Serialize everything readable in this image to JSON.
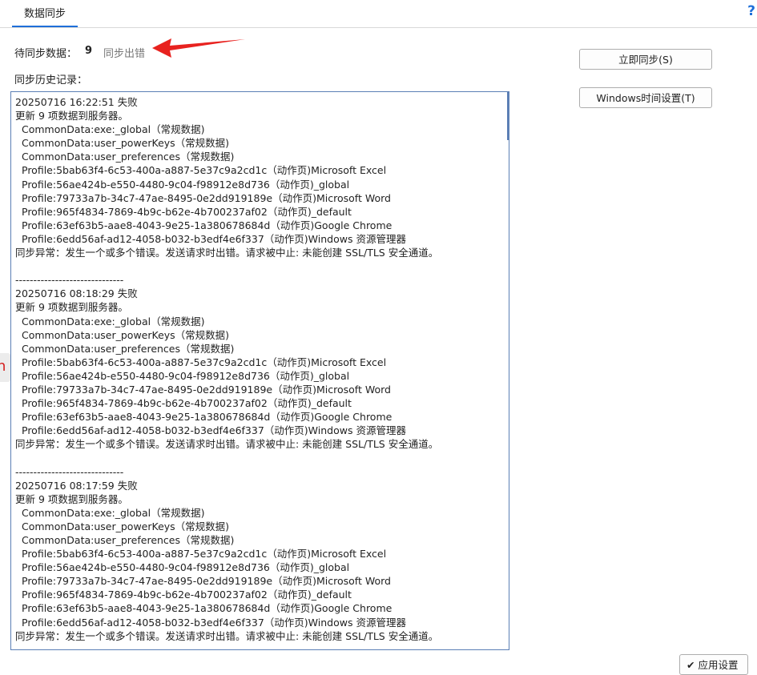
{
  "tabs": [
    {
      "label": "数据同步",
      "active": true
    }
  ],
  "help_label": "?",
  "pending": {
    "label": "待同步数据：",
    "count": "9",
    "status": "同步出错"
  },
  "history": {
    "label": "同步历史记录："
  },
  "buttons": {
    "sync_now": "立即同步(S)",
    "windows_time": "Windows时间设置(T)",
    "apply": "应用设置"
  },
  "side_tab_text": "n",
  "log_entries": [
    {
      "separator": "",
      "header": "20250716 16:22:51 失败",
      "summary": "更新 9 项数据到服务器。",
      "items": [
        "CommonData:exe:_global（常规数据)",
        "CommonData:user_powerKeys（常规数据)",
        "CommonData:user_preferences（常规数据)",
        "Profile:5bab63f4-6c53-400a-a887-5e37c9a2cd1c（动作页)Microsoft Excel",
        "Profile:56ae424b-e550-4480-9c04-f98912e8d736（动作页)_global",
        "Profile:79733a7b-34c7-47ae-8495-0e2dd919189e（动作页)Microsoft Word",
        "Profile:965f4834-7869-4b9c-b62e-4b700237af02（动作页)_default",
        "Profile:63ef63b5-aae8-4043-9e25-1a380678684d（动作页)Google Chrome",
        "Profile:6edd56af-ad12-4058-b032-b3edf4e6f337（动作页)Windows 资源管理器"
      ],
      "error": "同步异常：发生一个或多个错误。发送请求时出错。请求被中止: 未能创建 SSL/TLS 安全通道。"
    },
    {
      "separator": "------------------------------",
      "header": "20250716 08:18:29 失败",
      "summary": "更新 9 项数据到服务器。",
      "items": [
        "CommonData:exe:_global（常规数据)",
        "CommonData:user_powerKeys（常规数据)",
        "CommonData:user_preferences（常规数据)",
        "Profile:5bab63f4-6c53-400a-a887-5e37c9a2cd1c（动作页)Microsoft Excel",
        "Profile:56ae424b-e550-4480-9c04-f98912e8d736（动作页)_global",
        "Profile:79733a7b-34c7-47ae-8495-0e2dd919189e（动作页)Microsoft Word",
        "Profile:965f4834-7869-4b9c-b62e-4b700237af02（动作页)_default",
        "Profile:63ef63b5-aae8-4043-9e25-1a380678684d（动作页)Google Chrome",
        "Profile:6edd56af-ad12-4058-b032-b3edf4e6f337（动作页)Windows 资源管理器"
      ],
      "error": "同步异常：发生一个或多个错误。发送请求时出错。请求被中止: 未能创建 SSL/TLS 安全通道。"
    },
    {
      "separator": "------------------------------",
      "header": "20250716 08:17:59 失败",
      "summary": "更新 9 项数据到服务器。",
      "items": [
        "CommonData:exe:_global（常规数据)",
        "CommonData:user_powerKeys（常规数据)",
        "CommonData:user_preferences（常规数据)",
        "Profile:5bab63f4-6c53-400a-a887-5e37c9a2cd1c（动作页)Microsoft Excel",
        "Profile:56ae424b-e550-4480-9c04-f98912e8d736（动作页)_global",
        "Profile:79733a7b-34c7-47ae-8495-0e2dd919189e（动作页)Microsoft Word",
        "Profile:965f4834-7869-4b9c-b62e-4b700237af02（动作页)_default",
        "Profile:63ef63b5-aae8-4043-9e25-1a380678684d（动作页)Google Chrome",
        "Profile:6edd56af-ad12-4058-b032-b3edf4e6f337（动作页)Windows 资源管理器"
      ],
      "error": "同步异常：发生一个或多个错误。发送请求时出错。请求被中止: 未能创建 SSL/TLS 安全通道。"
    }
  ],
  "colors": {
    "accent": "#1e6fd9",
    "annotation_arrow": "#e8221f",
    "side_tab_text": "#d42020"
  }
}
